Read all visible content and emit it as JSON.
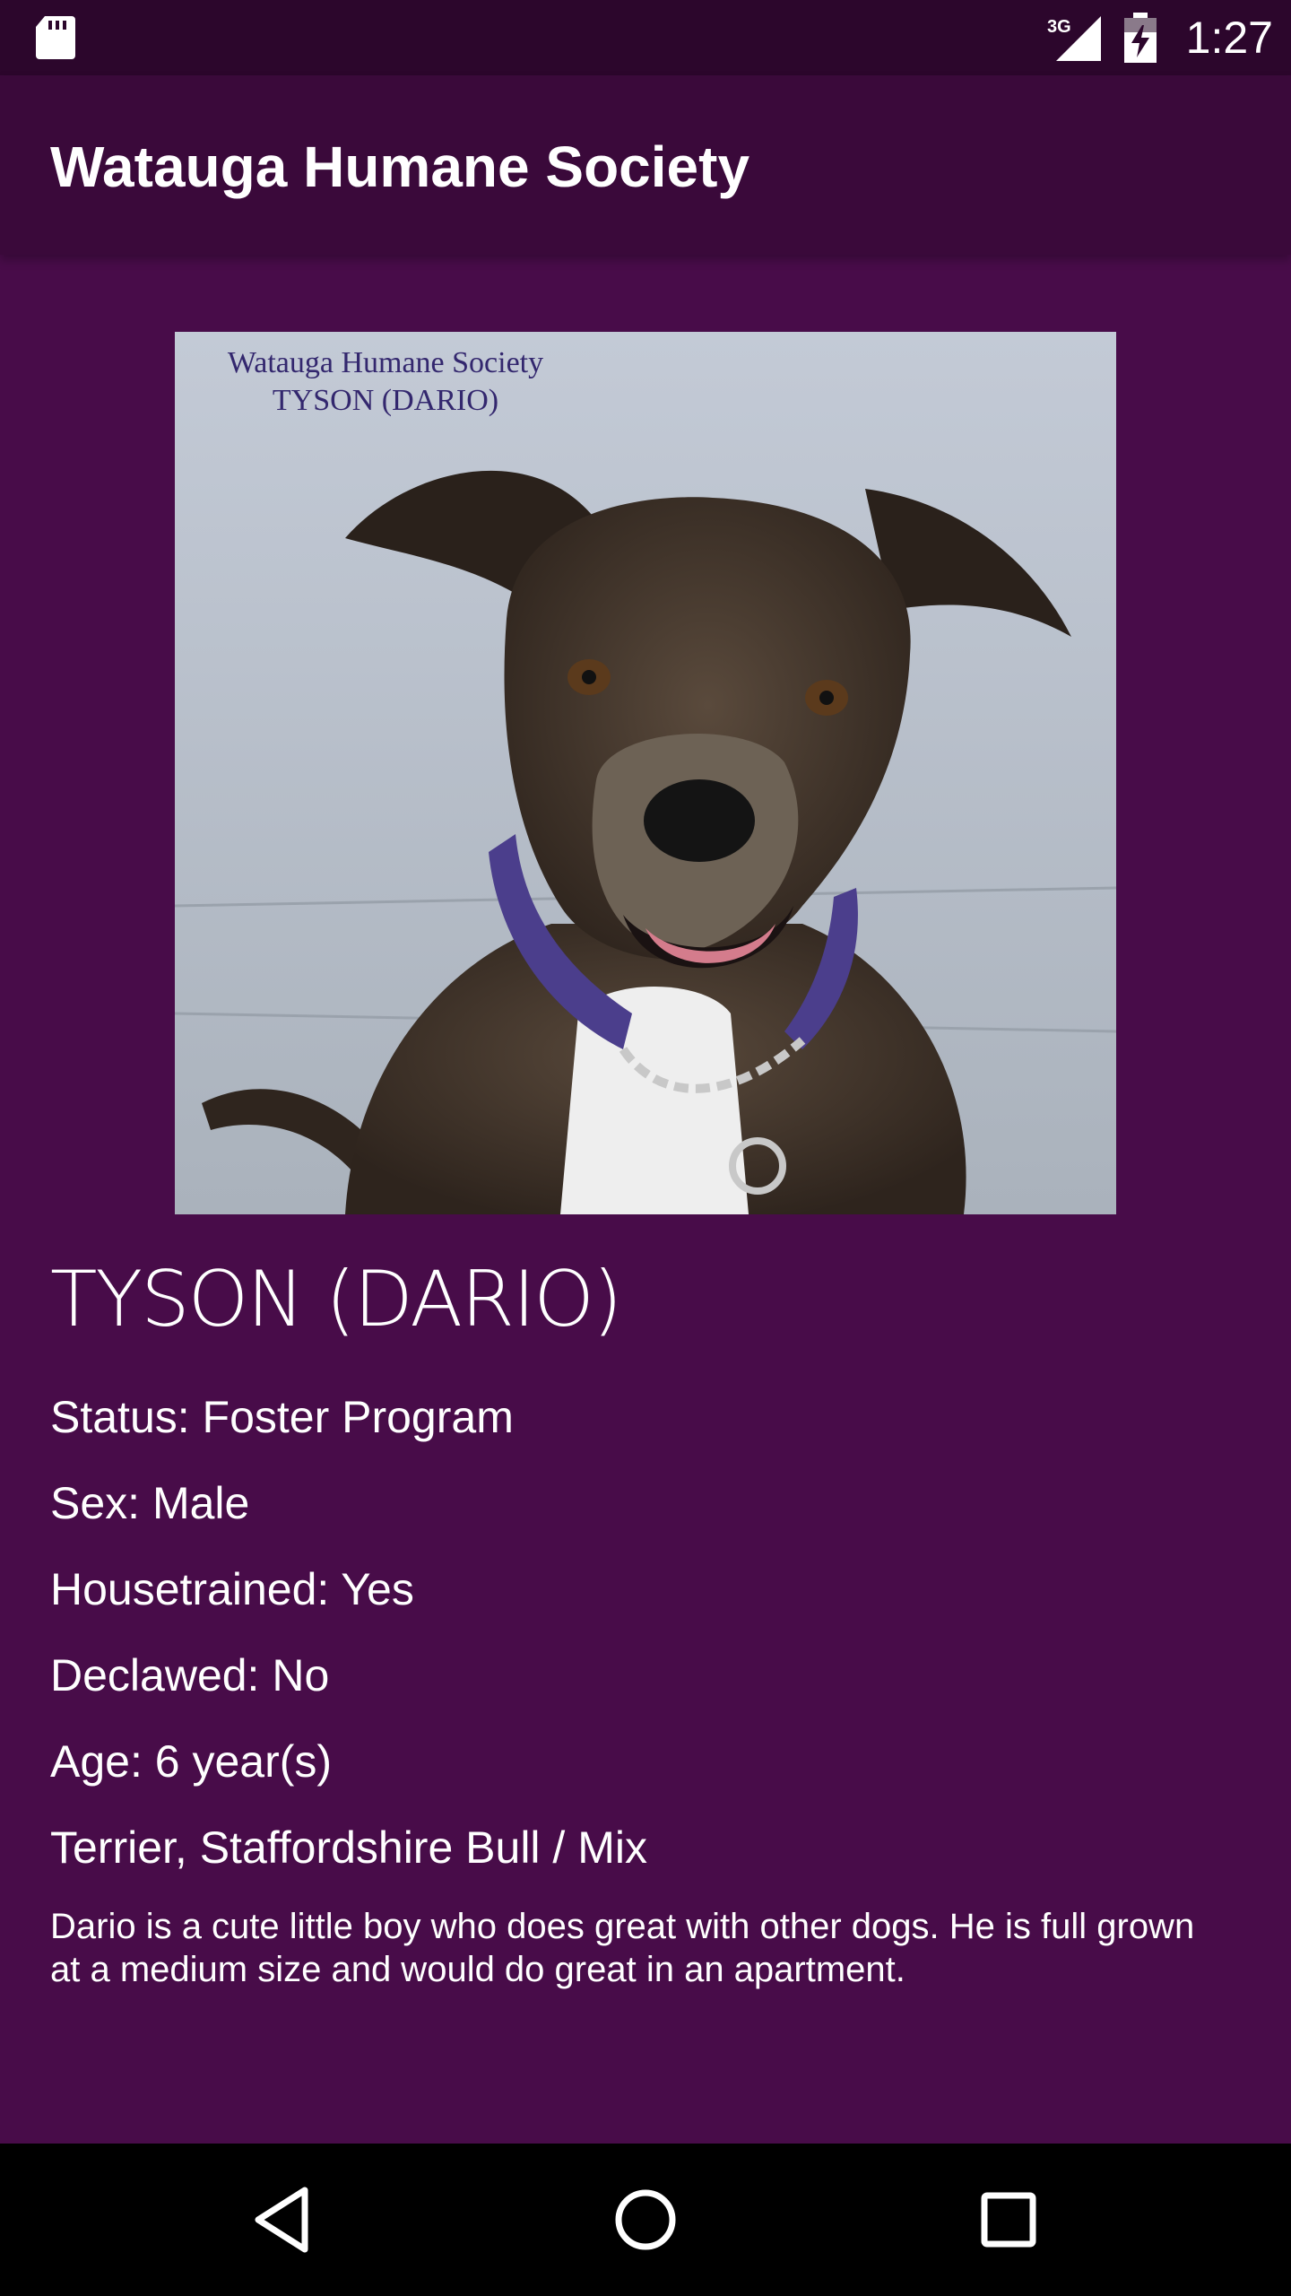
{
  "status_bar": {
    "network": "3G",
    "time": "1:27"
  },
  "app_bar": {
    "title": "Watauga Humane Society"
  },
  "pet": {
    "photo_caption_line1": "Watauga Humane Society",
    "photo_caption_line2": "TYSON (DARIO)",
    "name": "TYSON (DARIO)",
    "status": "Status: Foster Program",
    "sex": "Sex: Male",
    "housetrained": "Housetrained: Yes",
    "declawed": "Declawed: No",
    "age": "Age: 6 year(s)",
    "breed": "Terrier, Staffordshire Bull / Mix",
    "description": "Dario is a cute little boy who does great with other dogs. He is full grown at a medium size and would do great in an apartment."
  },
  "colors": {
    "background": "#480c49",
    "app_bar": "#3a093a",
    "status_bar": "#2c062c",
    "text": "#ffffff"
  }
}
